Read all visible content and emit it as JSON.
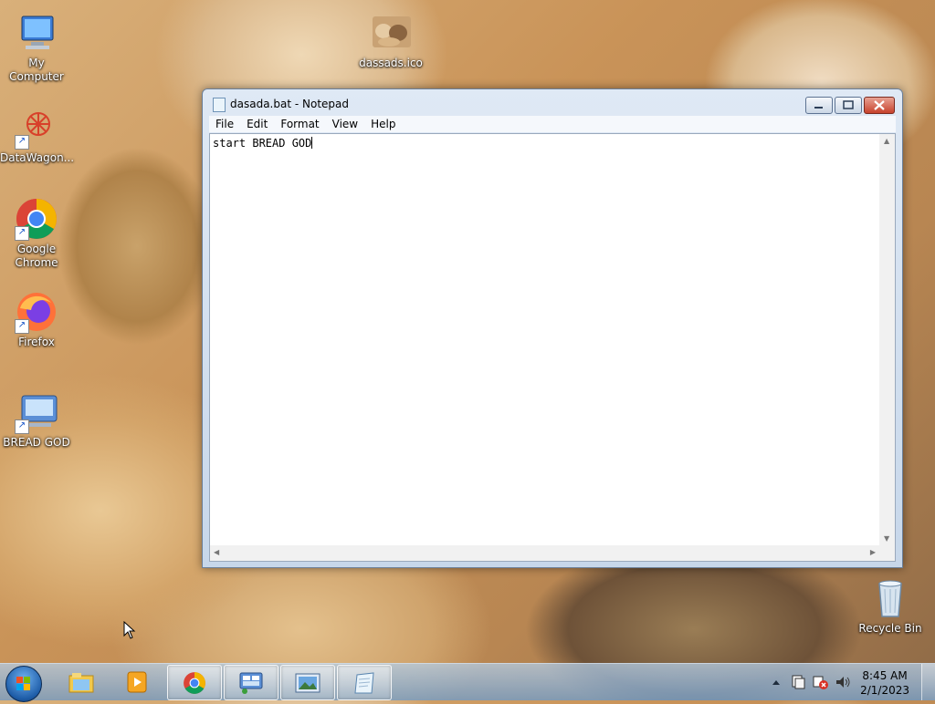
{
  "desktop": {
    "icons": [
      {
        "label": "My Computer"
      },
      {
        "label": "dassads.ico"
      },
      {
        "label": "DataWagon..."
      },
      {
        "label": "Google\nChrome"
      },
      {
        "label": "Firefox"
      },
      {
        "label": "BREAD GOD"
      },
      {
        "label": "Recycle Bin"
      }
    ]
  },
  "window": {
    "title": "dasada.bat - Notepad",
    "menu": [
      "File",
      "Edit",
      "Format",
      "View",
      "Help"
    ],
    "content": "start BREAD GOD"
  },
  "taskbar": {
    "pinned": [
      {
        "icon": "windows-explorer-icon"
      },
      {
        "icon": "media-player-icon"
      },
      {
        "icon": "chrome-icon"
      },
      {
        "icon": "remote-desktop-icon"
      },
      {
        "icon": "picture-viewer-icon"
      },
      {
        "icon": "notepad-icon",
        "active": true
      }
    ],
    "clock_time": "8:45 AM",
    "clock_date": "2/1/2023"
  }
}
